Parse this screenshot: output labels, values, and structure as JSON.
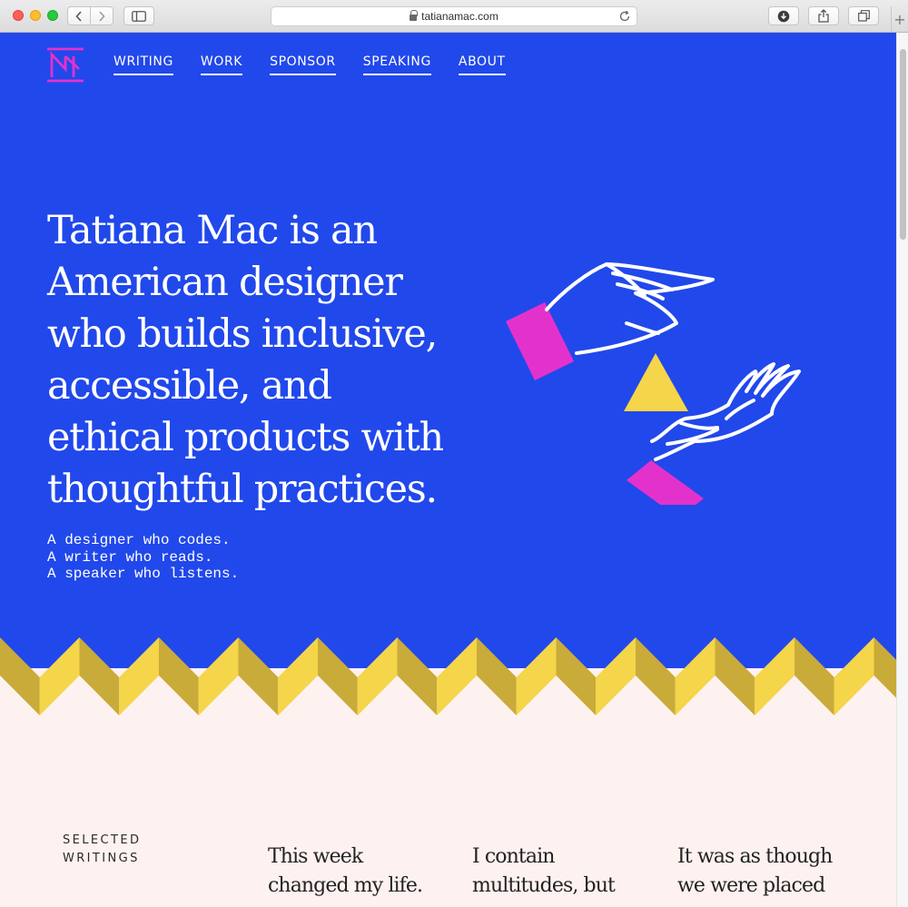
{
  "browser": {
    "url": "tatianamac.com"
  },
  "nav": {
    "items": [
      {
        "label": "WRITING"
      },
      {
        "label": "WORK"
      },
      {
        "label": "SPONSOR"
      },
      {
        "label": "SPEAKING"
      },
      {
        "label": "ABOUT"
      }
    ]
  },
  "hero": {
    "headline": "Tatiana Mac is an American designer who builds inclusive, accessible, and ethical products with thoughtful practices.",
    "tagline": [
      "A designer who codes.",
      "A writer who reads.",
      "A speaker who listens."
    ]
  },
  "writings": {
    "section_label_line1": "SELECTED",
    "section_label_line2": "WRITINGS",
    "items": [
      {
        "line1": "This week",
        "line2": "changed my life."
      },
      {
        "line1": "I contain",
        "line2": "multitudes, but"
      },
      {
        "line1": "It was as though",
        "line2": "we were placed"
      }
    ]
  },
  "colors": {
    "hero_bg": "#2148eb",
    "lower_bg": "#fdf2f0",
    "accent_magenta": "#e332cc",
    "accent_yellow": "#f5d549"
  }
}
